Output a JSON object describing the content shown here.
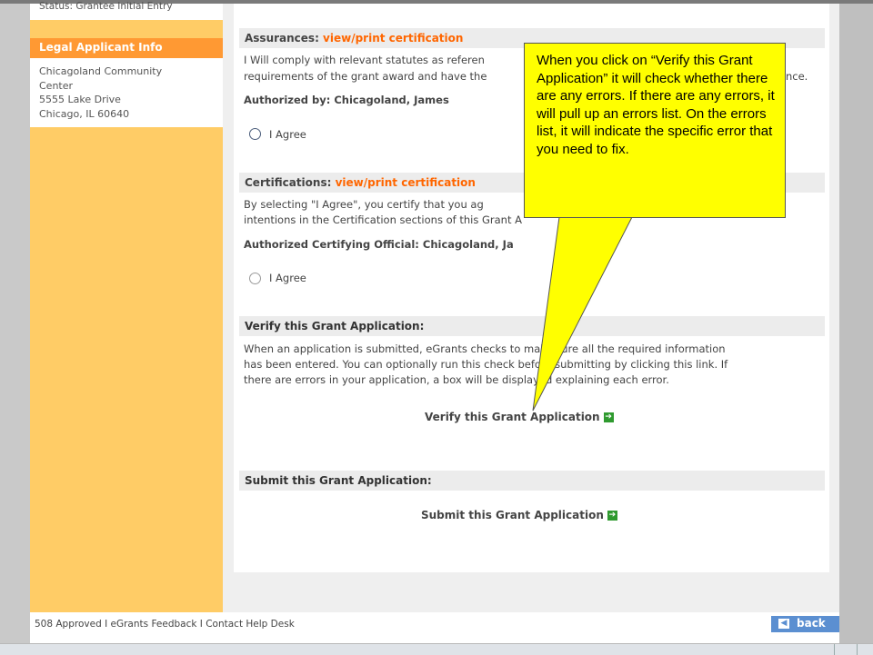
{
  "sidebar": {
    "status_text": "Status: Grantee Initial Entry",
    "legal_header": "Legal Applicant Info",
    "address": [
      "Chicagoland Community",
      "Center",
      "5555 Lake Drive",
      "Chicago, IL 60640"
    ]
  },
  "assurances": {
    "title": "Assurances: ",
    "link": "view/print certification",
    "line1": "I Will comply with relevant statutes as referen",
    "line1_tail": "nce.",
    "line2": "requirements of the grant award and have the",
    "authorized": "Authorized by: Chicagoland, James",
    "agree_label": "I Agree"
  },
  "certifications": {
    "title": "Certifications: ",
    "link": "view/print certification",
    "line1": "By selecting \"I Agree\", you certify that you ag",
    "line2": "intentions in the Certification sections of this Grant A",
    "official": "Authorized Certifying Official: Chicagoland, Ja",
    "agree_label": "I Agree"
  },
  "verify": {
    "title": "Verify this Grant Application:",
    "line1": "When an application is submitted, eGrants checks to make sure all the required information",
    "line2": "has been entered. You can optionally run this check before submitting by clicking this link. If",
    "line3": "there are errors in your application, a box will be displayed explaining each error.",
    "link": "Verify this Grant Application"
  },
  "submit": {
    "title": "Submit this Grant Application:",
    "link": "Submit this Grant Application"
  },
  "footer": {
    "links_text": "508 Approved  I  eGrants Feedback  I  Contact Help Desk",
    "back_label": "back"
  },
  "callout": {
    "text": "When you click on “Verify this Grant Application” it will check whether there are any errors.  If there are any errors, it will pull up an errors list.  On the errors list, it will indicate the specific error that you need to fix."
  },
  "colors": {
    "sidebar": "#ffcc66",
    "sidebar_header": "#ff9933",
    "link_orange": "#ff6600",
    "callout_yellow": "#ffff00",
    "back_button": "#5b8fd1"
  }
}
